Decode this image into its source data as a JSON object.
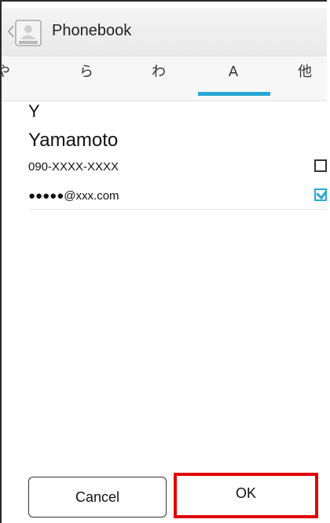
{
  "titlebar": {
    "title": "Phonebook",
    "icon": "phonebook-app-icon"
  },
  "tabs": [
    {
      "label": "や"
    },
    {
      "label": "ら"
    },
    {
      "label": "わ"
    },
    {
      "label": "A",
      "selected": true
    },
    {
      "label": "他"
    }
  ],
  "accent_color": "#29a6d6",
  "list": {
    "section_header": "Y",
    "contact_name": "Yamamoto",
    "phone": {
      "value": "090-XXXX-XXXX",
      "checked": false
    },
    "email": {
      "value": "●●●●●@xxx.com",
      "checked": true
    }
  },
  "buttons": {
    "cancel_label": "Cancel",
    "ok_label": "OK"
  }
}
